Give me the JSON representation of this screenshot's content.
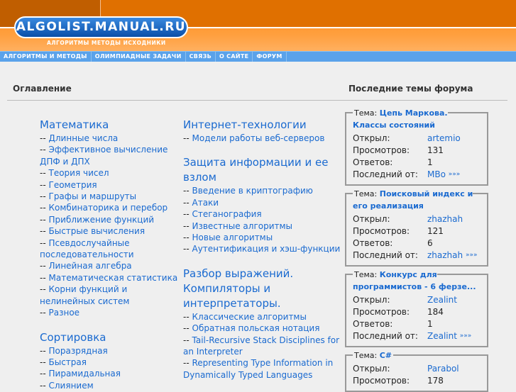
{
  "header": {
    "logo": "ALGOLIST.MANUAL.RU",
    "tagline": "АЛГОРИТМЫ МЕТОДЫ ИСХОДНИКИ"
  },
  "nav": [
    "АЛГОРИТМЫ И МЕТОДЫ",
    "ОЛИМПИАДНЫЕ ЗАДАЧИ",
    "СВЯЗЬ",
    "О САЙТЕ",
    "ФОРУМ"
  ],
  "toc_title": "Оглавление",
  "forum_title": "Последние темы форума",
  "col1": [
    {
      "heading": "Математика",
      "items": [
        "Длинные числа",
        "Эффективное вычисление ДПФ и ДПХ",
        "Теория чисел",
        "Геометрия",
        "Графы и маршруты",
        "Комбинаторика и перебор",
        "Приближение функций",
        "Быстрые вычисления",
        "Псевдослучайные последовательности",
        "Линейная алгебра",
        "Математическая статистика",
        "Корни функций и нелинейных систем",
        "Разное"
      ]
    },
    {
      "heading": "Сортировка",
      "items": [
        "Поразрядная",
        "Быстрая",
        "Пирамидальная",
        "Слиянием"
      ]
    }
  ],
  "col2": [
    {
      "heading": "Интернет-технологии",
      "items": [
        "Модели работы веб-серверов"
      ]
    },
    {
      "heading": "Защита информации и ее взлом",
      "items": [
        "Введение в криптографию",
        "Атаки",
        "Стеганография",
        "Известные алгоритмы",
        "Новые алгоритмы",
        "Аутентификация и хэш-функции"
      ]
    },
    {
      "heading": "Разбор выражений. Компиляторы и интерпретаторы.",
      "items": [
        "Классические алгоритмы",
        "Обратная польская нотация",
        "Tail-Recursive Stack Disciplines for an Interpreter",
        "Representing Type Information in Dynamically Typed Languages"
      ]
    }
  ],
  "dash": "--",
  "labels": {
    "topic": "Тема:",
    "opened": "Открыл:",
    "views": "Просмотров:",
    "replies": "Ответов:",
    "last": "Последний от:",
    "more": "»»»"
  },
  "topics": [
    {
      "title": "Цепь Маркова. Классы состояний",
      "opened": "artemio",
      "views": "131",
      "replies": "1",
      "last": "MBo"
    },
    {
      "title": "Поисковый индекс и его реализация",
      "opened": "zhazhah",
      "views": "121",
      "replies": "6",
      "last": "zhazhah"
    },
    {
      "title": "Конкурс для программистов - 6 ферзе...",
      "opened": "Zealint",
      "views": "184",
      "replies": "1",
      "last": "Zealint"
    },
    {
      "title": "C#",
      "opened": "Parabol",
      "views": "178",
      "replies": "",
      "last": ""
    }
  ]
}
